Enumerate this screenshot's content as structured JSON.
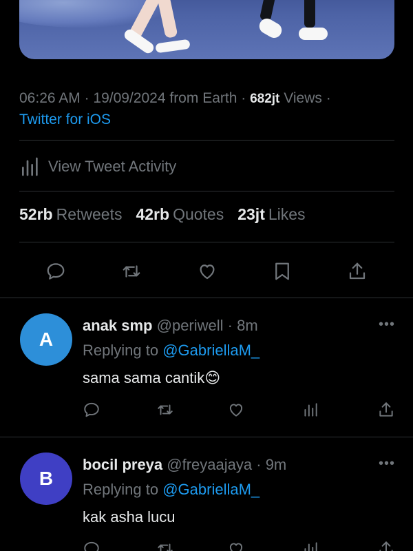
{
  "tweet": {
    "time": "06:26 AM",
    "date": "19/09/2024",
    "location": "from Earth",
    "views_count": "682jt",
    "views_label": "Views",
    "source": "Twitter for iOS",
    "activity_label": "View Tweet Activity",
    "stats": [
      {
        "count": "52rb",
        "label": "Retweets"
      },
      {
        "count": "42rb",
        "label": "Quotes"
      },
      {
        "count": "23jt",
        "label": "Likes"
      }
    ]
  },
  "replies": [
    {
      "avatar_letter": "A",
      "avatar_color": "#2d8fd9",
      "name": "anak smp",
      "handle": "@periwell",
      "time": "8m",
      "replying_prefix": "Replying to",
      "replying_to": "@GabriellaM_",
      "text": "sama sama cantik😊"
    },
    {
      "avatar_letter": "B",
      "avatar_color": "#3f3fc4",
      "name": "bocil preya",
      "handle": "@freyaajaya",
      "time": "9m",
      "replying_prefix": "Replying to",
      "replying_to": "@GabriellaM_",
      "text": "kak asha lucu"
    }
  ],
  "colors": {
    "background": "#000000",
    "accent": "#1d9bf0",
    "muted": "#71767b",
    "text": "#e7e9ea"
  },
  "icons": [
    "reply-icon",
    "retweet-icon",
    "like-icon",
    "bookmark-icon",
    "share-icon",
    "analytics-icon",
    "more-icon"
  ]
}
